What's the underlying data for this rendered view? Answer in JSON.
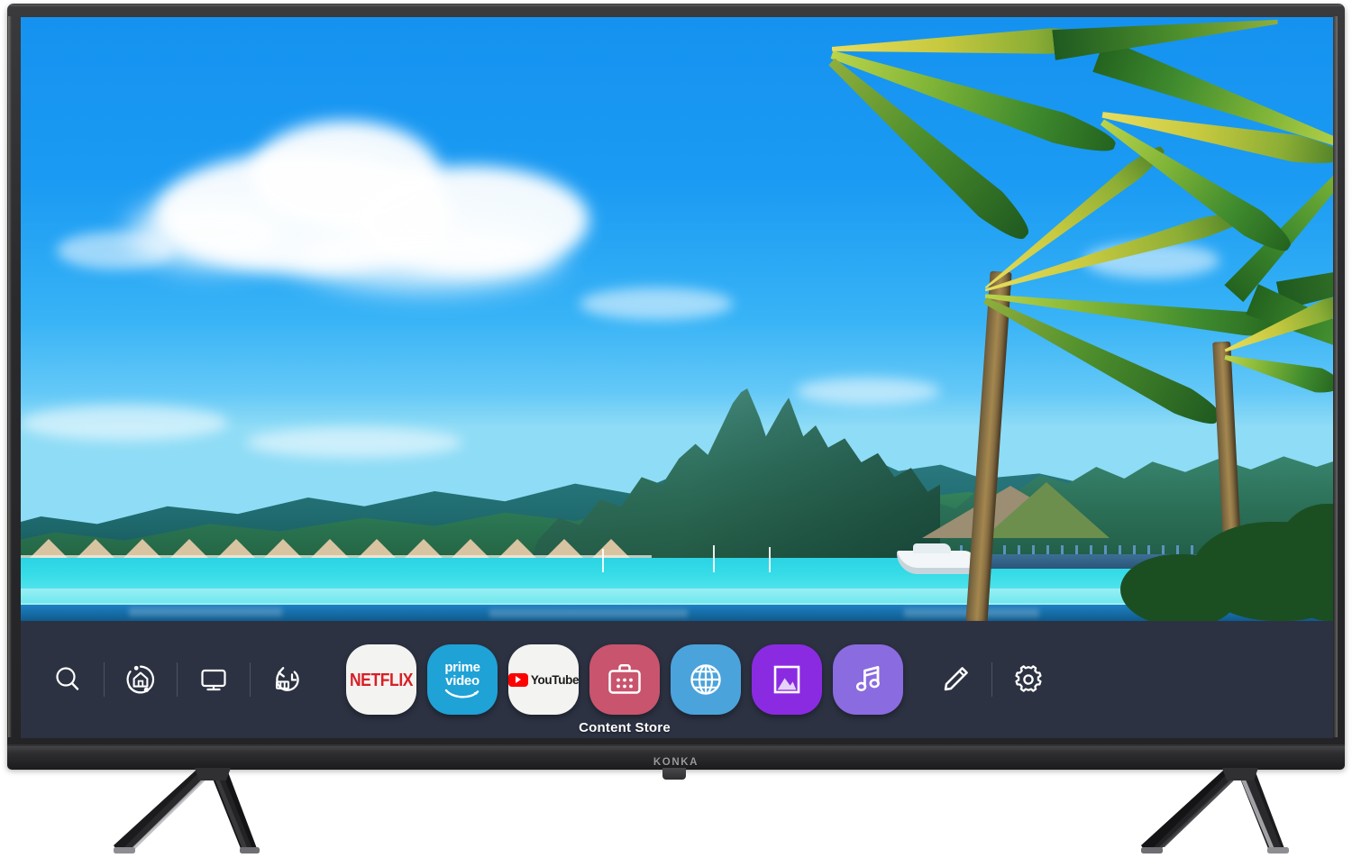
{
  "product": {
    "brand": "KONKA",
    "device_type": "Smart LED Television",
    "stand_style": "two-piece chevron feet"
  },
  "screen": {
    "content_type": "tropical lagoon wallpaper",
    "scene_description": "Bora Bora lagoon with Mount Otemanu, overwater bungalows, palm trees and a boat"
  },
  "launcher": {
    "background_color": "#2C3242",
    "quick_actions": [
      {
        "name": "search",
        "icon": "search-icon",
        "label": "Search"
      },
      {
        "name": "home_dashboard",
        "icon": "home-dashboard-icon",
        "label": "Home Dashboard"
      },
      {
        "name": "inputs",
        "icon": "tv-display-icon",
        "label": "Inputs"
      },
      {
        "name": "recents",
        "icon": "recent-history-icon",
        "label": "Recents"
      }
    ],
    "apps": [
      {
        "name": "netflix",
        "label": "NETFLIX",
        "tile_color": "#F3F3F1",
        "text_color": "#D81F26",
        "selected": false
      },
      {
        "name": "prime-video",
        "label_line1": "prime",
        "label_line2": "video",
        "tile_color": "#1FA2D6",
        "text_color": "#FFFFFF",
        "selected": false
      },
      {
        "name": "youtube",
        "label": "YouTube",
        "tile_color": "#F3F3F1",
        "text_color": "#1A1A1A",
        "accent_color": "#FF0000",
        "selected": false
      },
      {
        "name": "content-store",
        "label": "Content Store",
        "tile_color": "#C9546E",
        "icon": "shopping-bag-icon",
        "selected": true
      },
      {
        "name": "web-browser",
        "label": "Web Browser",
        "tile_color": "#4BA3DC",
        "icon": "globe-icon",
        "selected": false
      },
      {
        "name": "photo-video",
        "label": "Photo & Video",
        "tile_color": "#8A2BE2",
        "icon": "picture-icon",
        "selected": false
      },
      {
        "name": "music",
        "label": "Music",
        "tile_color": "#8A6BE0",
        "icon": "music-note-icon",
        "selected": false
      }
    ],
    "tail_actions": [
      {
        "name": "edit",
        "icon": "pencil-edit-icon",
        "label": "Edit"
      },
      {
        "name": "settings",
        "icon": "gear-settings-icon",
        "label": "Settings"
      }
    ],
    "selected_app_label": "Content Store"
  },
  "colors": {
    "bezel": "#2A2A2C",
    "chin": "#2B2B2D",
    "brand_text": "#9A9A9E",
    "launcher_bg": "#2C3242",
    "sky": "#1592F0",
    "lagoon": "#35DCE7",
    "pool": "#176EA8"
  }
}
